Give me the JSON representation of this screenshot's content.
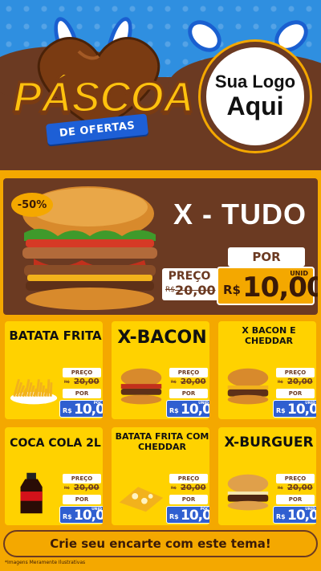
{
  "header": {
    "title": "PÁSCOA",
    "ribbon": "DE OFERTAS",
    "logo_line1": "Sua Logo",
    "logo_line2": "Aqui"
  },
  "featured": {
    "discount": "-50%",
    "name": "X - TUDO",
    "preco_label": "PREÇO",
    "por_label": "POR",
    "old_currency": "R$",
    "old_price": "20,00",
    "currency": "R$",
    "price": "10,00",
    "unit": "UNID"
  },
  "products": [
    {
      "name": "BATATA FRITA",
      "preco_label": "PREÇO",
      "old_currency": "R$",
      "old_price": "20,00",
      "por_label": "POR",
      "currency": "R$",
      "price": "10,00",
      "unit": "POC"
    },
    {
      "name": "X-BACON",
      "preco_label": "PREÇO",
      "old_currency": "R$",
      "old_price": "20,00",
      "por_label": "POR",
      "currency": "R$",
      "price": "10,00",
      "unit": "UNID"
    },
    {
      "name": "X BACON E CHEDDAR",
      "preco_label": "PREÇO",
      "old_currency": "R$",
      "old_price": "20,00",
      "por_label": "POR",
      "currency": "R$",
      "price": "10,00",
      "unit": "UNID"
    },
    {
      "name": "COCA COLA 2L",
      "preco_label": "PREÇO",
      "old_currency": "R$",
      "old_price": "20,00",
      "por_label": "POR",
      "currency": "R$",
      "price": "10,00",
      "unit": "UNID"
    },
    {
      "name": "BATATA FRITA COM CHEDDAR",
      "preco_label": "PREÇO",
      "old_currency": "R$",
      "old_price": "20,00",
      "por_label": "POR",
      "currency": "R$",
      "price": "10,00",
      "unit": "POC"
    },
    {
      "name": "X-BURGUER",
      "preco_label": "PREÇO",
      "old_currency": "R$",
      "old_price": "20,00",
      "por_label": "POR",
      "currency": "R$",
      "price": "10,00",
      "unit": "UNID"
    }
  ],
  "footer": {
    "cta": "Crie seu encarte com este tema!",
    "disclaimer": "*Imagens Meramente Ilustrativas"
  },
  "colors": {
    "chocolate": "#6b3a22",
    "gold": "#f4a800",
    "yellow": "#ffd200",
    "blue": "#2f8fe0",
    "price_blue": "#2f5fd0"
  }
}
